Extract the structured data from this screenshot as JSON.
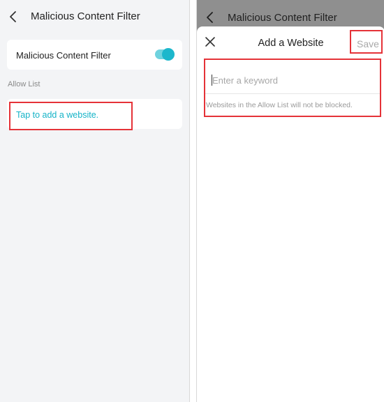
{
  "left_screen": {
    "header": {
      "title": "Malicious Content Filter",
      "back_icon": "chevron-left-icon"
    },
    "filter_card": {
      "label": "Malicious Content Filter",
      "toggle_on": true
    },
    "section_label": "Allow List",
    "add_website": {
      "label": "Tap to add a website."
    }
  },
  "right_screen": {
    "background_header": {
      "title": "Malicious Content Filter",
      "back_icon": "chevron-left-icon"
    },
    "sheet": {
      "close_icon": "close-icon",
      "title": "Add a Website",
      "save_label": "Save",
      "keyword_input": {
        "value": "",
        "placeholder": "Enter a keyword"
      },
      "hint": "Websites in the Allow List will not be blocked."
    }
  },
  "colors": {
    "accent": "#14b3c7",
    "toggle_track": "#6fd2de",
    "highlight": "#e53238",
    "dim_overlay": "#8f8f8f",
    "page_bg": "#f3f4f6"
  }
}
